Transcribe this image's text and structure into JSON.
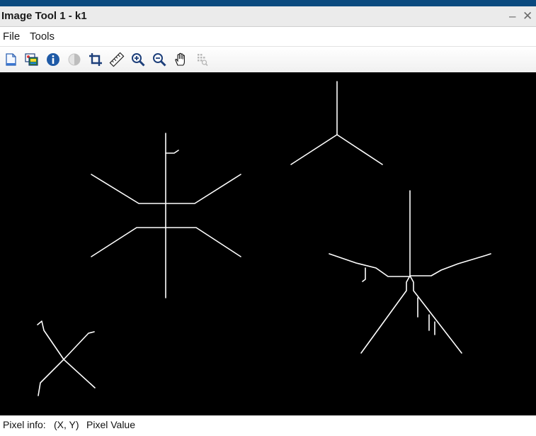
{
  "window": {
    "title": "Image Tool 1 - k1",
    "minimize_glyph": "–",
    "close_glyph": "✕"
  },
  "menu": {
    "items": [
      {
        "label": "File"
      },
      {
        "label": "Tools"
      }
    ]
  },
  "toolbar": {
    "tools": [
      {
        "icon": "new-document-icon"
      },
      {
        "icon": "print-to-figure-icon"
      },
      {
        "icon": "image-info-icon"
      },
      {
        "icon": "contrast-icon"
      },
      {
        "icon": "crop-icon"
      },
      {
        "icon": "measure-distance-icon"
      },
      {
        "icon": "zoom-in-icon"
      },
      {
        "icon": "zoom-out-icon"
      },
      {
        "icon": "pan-hand-icon"
      },
      {
        "icon": "pixel-region-icon"
      }
    ]
  },
  "canvas": {
    "background": "#000000",
    "stroke": "#ffffff"
  },
  "status": {
    "label": "Pixel info:",
    "coords": "(X, Y)",
    "value": "Pixel Value"
  },
  "colors": {
    "topbar": "#0b4a7f",
    "titlebar": "#ebebeb",
    "info_icon": "#1f5aa6"
  }
}
